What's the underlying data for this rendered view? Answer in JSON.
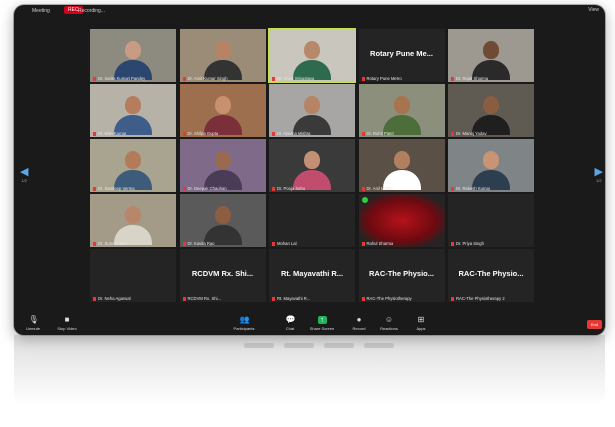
{
  "topbar": {
    "info_label": "Meeting",
    "recording_badge": "REC",
    "recording_label": "Recording...",
    "view_label": "View"
  },
  "nav": {
    "left_arrow": "◀",
    "right_arrow": "▶",
    "left_page": "1/2",
    "right_page": "1/2"
  },
  "tiles": [
    {
      "name": "Dr. Sarita Kumari Pandey",
      "type": "video",
      "bg": "#8d8a80",
      "skin": "#c99b82",
      "shirt": "#2b4770"
    },
    {
      "name": "Dr. Amit Kumar Singh",
      "type": "video",
      "bg": "#9a8c77",
      "skin": "#b88365",
      "shirt": "#333333"
    },
    {
      "name": "Dr. Vivek Srivastava",
      "type": "video",
      "bg": "#c9c6bd",
      "skin": "#b7896b",
      "shirt": "#2e6b4e",
      "active": true
    },
    {
      "name": "Rotary Pune Metro",
      "type": "text",
      "big": "Rotary Pune Me..."
    },
    {
      "name": "Dr. Rajat Sharma",
      "type": "video",
      "bg": "#9d9890",
      "skin": "#6f4a35",
      "shirt": "#2a2a2a"
    },
    {
      "name": "Dr. Nitin Kumar",
      "type": "video",
      "bg": "#b6b2a8",
      "skin": "#b57d5e",
      "shirt": "#3e5d8a"
    },
    {
      "name": "Dr. Shilpa Gupta",
      "type": "video",
      "bg": "#9d6f4e",
      "skin": "#c7906e",
      "shirt": "#7a2f3a"
    },
    {
      "name": "Dr. Aparna Mishra",
      "type": "video",
      "bg": "#a7a6a4",
      "skin": "#b68465",
      "shirt": "#3a3a3a"
    },
    {
      "name": "Dr. Rohit Patel",
      "type": "video",
      "bg": "#8b8f7c",
      "skin": "#a7744f",
      "shirt": "#4d6e3a"
    },
    {
      "name": "Dr. Manoj Yadav",
      "type": "video",
      "bg": "#5f5a52",
      "skin": "#8a5c40",
      "shirt": "#1f1f1f"
    },
    {
      "name": "Dr. Sandeep Verma",
      "type": "video",
      "bg": "#a9a48f",
      "skin": "#b27c5b",
      "shirt": "#3d5c7a"
    },
    {
      "name": "Dr. Deepak Chauhan",
      "type": "video",
      "bg": "#806a8a",
      "skin": "#9a6a4f",
      "shirt": "#4a3b56"
    },
    {
      "name": "Dr. Pooja Sahu",
      "type": "video",
      "bg": "#3a3a3a",
      "skin": "#c49075",
      "shirt": "#c14d6c"
    },
    {
      "name": "Dr. Anil Mehta",
      "type": "video",
      "bg": "#5a5046",
      "skin": "#b18060",
      "shirt": "#ffffff"
    },
    {
      "name": "Dr. Rakesh Kumar",
      "type": "video",
      "bg": "#7f8486",
      "skin": "#c99474",
      "shirt": "#2c3e50"
    },
    {
      "name": "Dr. Suresh Jain",
      "type": "video",
      "bg": "#a49a88",
      "skin": "#b8876a",
      "shirt": "#d8d4c8"
    },
    {
      "name": "Dr. Kavita Rao",
      "type": "video",
      "bg": "#5a5a5a",
      "skin": "#8d5d42",
      "shirt": "#333333"
    },
    {
      "name": "Mohan Lal",
      "type": "blank"
    },
    {
      "name": "Rahul Sharma",
      "type": "red"
    },
    {
      "name": "Dr. Priya Singh",
      "type": "blank"
    },
    {
      "name": "Dr. Neha Agarwal",
      "type": "blank"
    },
    {
      "name": "RCDVM Rx. Shi...",
      "type": "text",
      "big": "RCDVM Rx. Shi..."
    },
    {
      "name": "Rt. Mayavathi R...",
      "type": "text",
      "big": "Rt. Mayavathi R..."
    },
    {
      "name": "RAC-The Physiotherapy",
      "type": "text",
      "big": "RAC-The Physio..."
    },
    {
      "name": "RAC-The Physiotherapy 2",
      "type": "text",
      "big": "RAC-The Physio..."
    }
  ],
  "toolbar": {
    "mute": "Unmute",
    "video": "Stop Video",
    "participants": "Participants",
    "participants_count": "25",
    "chat": "Chat",
    "share": "Share Screen",
    "record": "Record",
    "reactions": "Reactions",
    "apps": "Apps",
    "end": "End"
  },
  "icons": {
    "mute": "mic-icon",
    "video": "camera-icon",
    "participants": "participants-icon",
    "chat": "chat-icon",
    "share": "share-screen-icon",
    "record": "record-icon",
    "reactions": "reactions-icon",
    "apps": "apps-icon"
  }
}
